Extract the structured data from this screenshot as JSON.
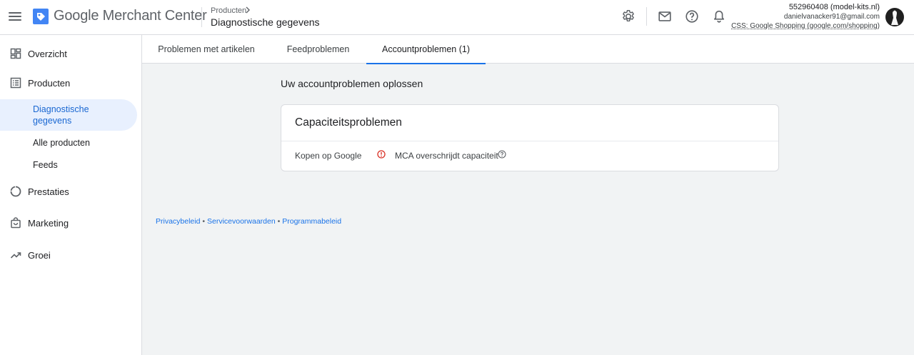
{
  "header": {
    "brand": "Google Merchant Center",
    "breadcrumb_parent": "Producten",
    "breadcrumb_current": "Diagnostische gegevens",
    "account_id": "552960408 (model-kits.nl)",
    "account_email": "danielvanacker91@gmail.com",
    "account_css": "CSS: Google Shopping (google.com/shopping)",
    "icons": [
      "menu-icon",
      "merchant-center-logo",
      "gear-icon",
      "mail-icon",
      "help-icon",
      "bell-icon",
      "avatar"
    ]
  },
  "sidebar": {
    "items": [
      {
        "label": "Overzicht",
        "icon": "dashboard-icon"
      },
      {
        "label": "Producten",
        "icon": "list-icon"
      },
      {
        "label": "Prestaties",
        "icon": "donut-chart-icon"
      },
      {
        "label": "Marketing",
        "icon": "shopping-bag-icon"
      },
      {
        "label": "Groei",
        "icon": "trending-up-icon"
      }
    ],
    "sub_items": [
      {
        "label": "Diagnostische gegevens",
        "active": true
      },
      {
        "label": "Alle producten"
      },
      {
        "label": "Feeds"
      }
    ]
  },
  "tabs": [
    {
      "label": "Problemen met artikelen"
    },
    {
      "label": "Feedproblemen"
    },
    {
      "label": "Accountproblemen (1)",
      "active": true
    }
  ],
  "main": {
    "section_title": "Uw accountproblemen oplossen",
    "card": {
      "title": "Capaciteitsproblemen",
      "row_label": "Kopen op Google",
      "row_value": "MCA overschrijdt capaciteit"
    }
  },
  "footer": {
    "links": [
      "Privacybeleid",
      "Servicevoorwaarden",
      "Programmabeleid"
    ],
    "separator": "•"
  },
  "colors": {
    "accent": "#1a73e8",
    "active_bg": "#e8f0fe",
    "error": "#d93025",
    "page_bg": "#f1f3f4"
  }
}
